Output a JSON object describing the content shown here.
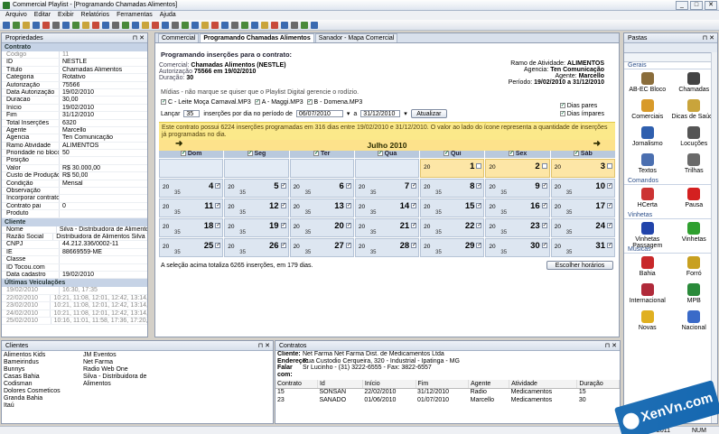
{
  "title": "Commercial Playlist - [Programando Chamadas Alimentos]",
  "window_buttons": [
    "_",
    "□",
    "✕"
  ],
  "menu": [
    "Arquivo",
    "Editar",
    "Exibir",
    "Relatórios",
    "Ferramentas",
    "Ajuda"
  ],
  "props": {
    "header": "Propriedades",
    "sec_contrato": "Contrato",
    "rows": [
      {
        "k": "Código",
        "v": "11",
        "grey": true
      },
      {
        "k": "ID",
        "v": "NESTLE"
      },
      {
        "k": "Título",
        "v": "Chamadas Alimentos"
      },
      {
        "k": "Categoria",
        "v": "Rotativo"
      },
      {
        "k": "Autorização",
        "v": "75566"
      },
      {
        "k": "Data Autorização",
        "v": "19/02/2010"
      },
      {
        "k": "Duracao",
        "v": "30,00"
      },
      {
        "k": "Início",
        "v": "19/02/2010"
      },
      {
        "k": "Fim",
        "v": "31/12/2010"
      },
      {
        "k": "Total Inserções",
        "v": "6320"
      },
      {
        "k": "Agente",
        "v": "Marcello"
      },
      {
        "k": "Agencia",
        "v": "Ten Comunicação"
      },
      {
        "k": "Ramo Atividade",
        "v": "ALIMENTOS"
      },
      {
        "k": "Prioridade no bloco",
        "v": "50"
      },
      {
        "k": "Posição",
        "v": ""
      },
      {
        "k": "Valor",
        "v": "R$ 30.000,00"
      },
      {
        "k": "Custo de Produção",
        "v": "R$ 50,00"
      },
      {
        "k": "Condição",
        "v": "Mensal"
      },
      {
        "k": "Observação",
        "v": ""
      },
      {
        "k": "Incorporar contratos",
        "v": ""
      },
      {
        "k": "Contrato pai",
        "v": "0"
      },
      {
        "k": "Produto",
        "v": ""
      }
    ],
    "sec_cliente": "Cliente",
    "rows2": [
      {
        "k": "Nome",
        "v": "Silva - Distribuidora de Alimentos"
      },
      {
        "k": "Razão Social",
        "v": "Distribuidora de Alimentos Silva Ltda"
      },
      {
        "k": "CNPJ",
        "v": "44.212.336/0002-11"
      },
      {
        "k": "IE",
        "v": "88669559-ME"
      },
      {
        "k": "Classe",
        "v": ""
      },
      {
        "k": "ID Tocou.com",
        "v": ""
      },
      {
        "k": "Data cadastro",
        "v": "19/02/2010"
      }
    ],
    "sec_veic": "Últimas Veiculações",
    "rows3": [
      {
        "k": "19/02/2010",
        "v": "16:30, 17:35",
        "grey": true
      },
      {
        "k": "22/02/2010",
        "v": "10:21, 11:08, 12:01, 12:42, 13:14, 15:32",
        "grey": true
      },
      {
        "k": "23/02/2010",
        "v": "10:21, 11:08, 12:01, 12:42, 13:14, 15:32",
        "grey": true
      },
      {
        "k": "24/02/2010",
        "v": "10:21, 11:08, 12:01, 12:42, 13:14, 15:32",
        "grey": true
      },
      {
        "k": "25/02/2010",
        "v": "10:16, 11:01, 11:58, 17:36, 17:20, 17:32",
        "grey": true
      }
    ]
  },
  "tabs": [
    "Commercial",
    "Programando Chamadas Alimentos",
    "Sanador - Mapa Comercial"
  ],
  "sched": {
    "title": "Programando inserções para o contrato:",
    "comercial_lbl": "Comercial:",
    "comercial": "Chamadas Alimentos (NESTLE)",
    "autorizacao_lbl": "Autorização",
    "autorizacao": "75566 em 19/02/2010",
    "duracao_lbl": "Duração:",
    "duracao": "30",
    "ramo_lbl": "Ramo de Atividade:",
    "ramo": "ALIMENTOS",
    "agencia_lbl": "Agencia:",
    "agencia": "Ten Comunicação",
    "agente_lbl": "Agente:",
    "agente": "Marcello",
    "periodo_lbl": "Período:",
    "periodo": "19/02/2010 a 31/12/2010",
    "midias_hint": "Mídias - não marque se quiser que o Playlist Digital gerencie o rodízio.",
    "midias": [
      "C - Leite Moça Carnaval.MP3",
      "A - Maggi.MP3",
      "B - Domena.MP3"
    ],
    "lancar": "Lançar",
    "lancar_val": "35",
    "insercoes_txt": "inserções por dia no período de",
    "de": "06/07/2010",
    "a": "a",
    "ate": "31/12/2010",
    "atualizar": "Atualizar",
    "dias_pares": "Dias pares",
    "dias_impares": "Dias ímpares",
    "notice": "Este contrato possui 6224 inserções programadas em 316 dias entre 19/02/2010 e 31/12/2010. O valor ao lado do ícone representa a quantidade de inserções já programadas no dia.",
    "month": "Julho 2010",
    "days": [
      "Dom",
      "Seg",
      "Ter",
      "Qua",
      "Qui",
      "Sex",
      "Sáb"
    ],
    "cell_count": "20",
    "cell_sub": "35",
    "total": "A seleção acima totaliza 6265 inserções, em 179 dias.",
    "escolher": "Escolher horários"
  },
  "clients": {
    "header": "Clientes",
    "col1": [
      "Alimentos Kids",
      "Bameirindus",
      "Bunnys",
      "Casas Bahia",
      "Codisman",
      "Dolores Cosmeticos",
      "Granda Bahia",
      "Itaú"
    ],
    "col2": [
      "JM Eventos",
      "Net Farma",
      "Radio Web One",
      "Silva - Distribuidora de Alimentos"
    ]
  },
  "contracts": {
    "header": "Contratos",
    "cliente_lbl": "Cliente:",
    "cliente": "Net Farma   Net Farma Dist. de Medicamentos Ltda",
    "endereco_lbl": "Endereço:",
    "endereco": "Rua Custodio Cerqueira, 320 - Industrial - Ipatinga - MG",
    "falar_lbl": "Falar com:",
    "falar": "Sr Lucinho - (31) 3222-6555 - Fax: 3822-6557",
    "cols": [
      "Contrato",
      "Id",
      "Início",
      "Fim",
      "Agente",
      "Atividade",
      "Duração"
    ],
    "rows": [
      [
        "15",
        "SONSAN",
        "22/02/2010",
        "31/12/2010",
        "Radio",
        "Medicamentos",
        "15"
      ],
      [
        "23",
        "SANADO",
        "01/06/2010",
        "01/07/2010",
        "Marcello",
        "Medicamentos",
        "30"
      ]
    ]
  },
  "pastas": {
    "header": "Pastas",
    "groups": [
      {
        "name": "Gerais",
        "items": [
          {
            "label": "AB-EC Bloco",
            "color": "#8a6d3b"
          },
          {
            "label": "Chamadas",
            "color": "#444"
          },
          {
            "label": "Comerciais",
            "color": "#d89a2a"
          },
          {
            "label": "Dicas de Saúde",
            "color": "#c9a43b"
          },
          {
            "label": "Jornalismo",
            "color": "#2f5fae"
          },
          {
            "label": "Locuções",
            "color": "#555"
          },
          {
            "label": "Textos",
            "color": "#4b6fb0"
          },
          {
            "label": "Trilhas",
            "color": "#6a6a6a"
          }
        ]
      },
      {
        "name": "Comandos",
        "items": [
          {
            "label": "HCerta",
            "color": "#c33"
          },
          {
            "label": "Pausa",
            "color": "#d42020"
          }
        ]
      },
      {
        "name": "Vinhetas",
        "items": [
          {
            "label": "Vinhetas Passagem",
            "color": "#2244aa"
          },
          {
            "label": "Vinhetas",
            "color": "#2fa02f"
          }
        ]
      },
      {
        "name": "Músicas",
        "items": [
          {
            "label": "Bahia",
            "color": "#c8282a"
          },
          {
            "label": "Forró",
            "color": "#c8a020"
          },
          {
            "label": "Internacional",
            "color": "#b02a3a"
          },
          {
            "label": "MPB",
            "color": "#2a8a3a"
          },
          {
            "label": "Novas",
            "color": "#e0b020"
          },
          {
            "label": "Nacional",
            "color": "#3a6ac8"
          }
        ]
      }
    ]
  },
  "status": {
    "left": "",
    "date": "2011",
    "num": "NUM"
  },
  "watermark": "XenVn.com"
}
